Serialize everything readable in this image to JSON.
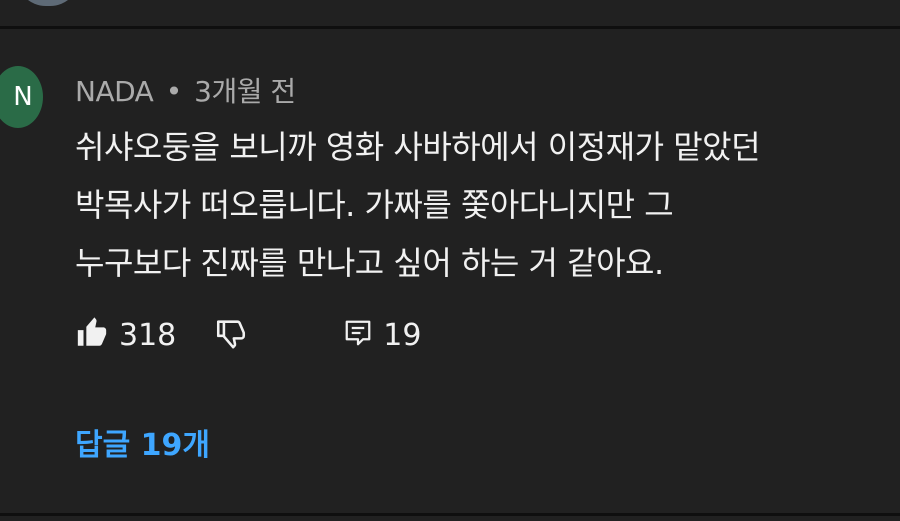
{
  "comment": {
    "avatar_initial": "N",
    "author": "NADA",
    "separator": "•",
    "time": "3개월 전",
    "lines": [
      "쉬샤오둥을 보니까 영화 사바하에서 이정재가 맡았던",
      "박목사가 떠오릅니다. 가짜를 쫓아다니지만 그",
      "누구보다 진짜를 만나고 싶어 하는 거 같아요."
    ],
    "likes": "318",
    "reply_count": "19",
    "replies_link": "답글 19개"
  },
  "icons": {
    "like": "thumbs-up-icon",
    "dislike": "thumbs-down-icon",
    "reply": "comment-icon"
  },
  "colors": {
    "background": "#212121",
    "text": "#f1f1f1",
    "meta": "#aaaaaa",
    "link": "#3ea6ff",
    "avatar": "#2a6b47"
  }
}
